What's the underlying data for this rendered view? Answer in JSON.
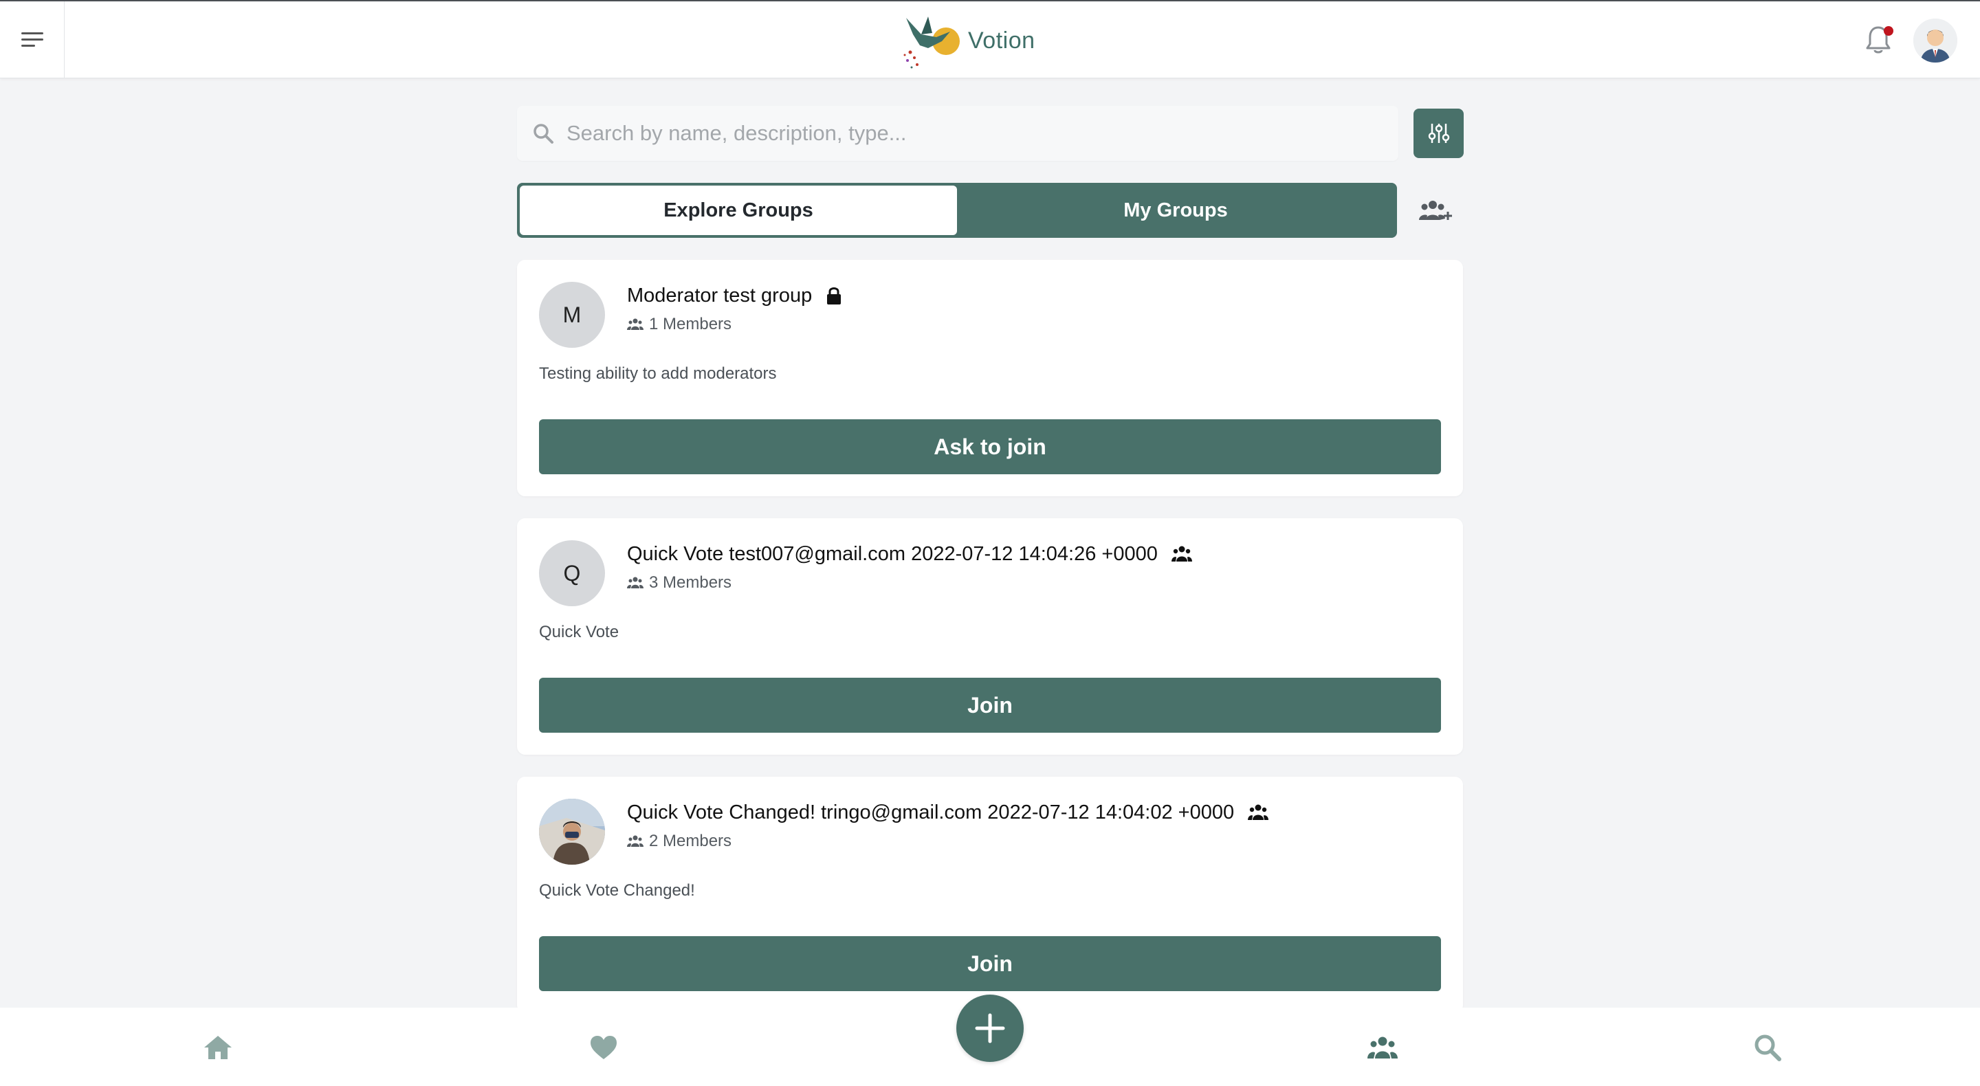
{
  "app": {
    "name": "Votion"
  },
  "header": {
    "menu_icon": "hamburger-icon",
    "notification_icon": "bell-icon",
    "profile_icon": "avatar-icon"
  },
  "search": {
    "placeholder": "Search by name, description, type...",
    "value": ""
  },
  "tabs": [
    {
      "label": "Explore Groups",
      "active": true
    },
    {
      "label": "My Groups",
      "active": false
    }
  ],
  "groups": [
    {
      "initial": "M",
      "name": "Moderator test group",
      "privacy_icon": "lock-icon",
      "members": "1 Members",
      "description": "Testing ability to add moderators",
      "action": "Ask to join"
    },
    {
      "initial": "Q",
      "name": "Quick Vote test007@gmail.com 2022-07-12 14:04:26 +0000",
      "privacy_icon": "group-icon",
      "members": "3 Members",
      "description": "Quick Vote",
      "action": "Join"
    },
    {
      "initial": "",
      "name": "Quick Vote Changed! tringo@gmail.com 2022-07-12 14:04:02 +0000",
      "privacy_icon": "group-icon",
      "members": "2 Members",
      "description": "Quick Vote Changed!",
      "action": "Join"
    }
  ],
  "bottom_nav": [
    "home-icon",
    "heart-icon",
    "plus-icon",
    "groups-icon",
    "search-icon"
  ],
  "colors": {
    "primary": "#49716a",
    "background": "#f3f4f6",
    "notification_dot": "#c0151e"
  }
}
